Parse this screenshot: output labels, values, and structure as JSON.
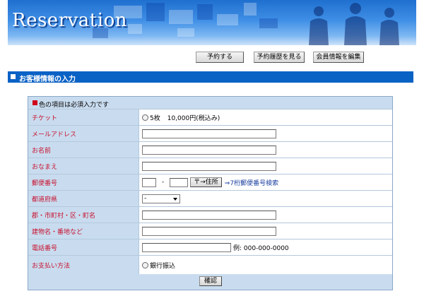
{
  "header": {
    "title": "Reservation"
  },
  "nav": {
    "reserve": "予約する",
    "history": "予約履歴を見る",
    "edit_member": "会員情報を編集"
  },
  "section": {
    "title": "お客様情報の入力"
  },
  "form": {
    "notice": "色の項目は必須入力です",
    "ticket": {
      "label": "チケット",
      "option": "5枚",
      "price": "10,000円(税込み)"
    },
    "email": {
      "label": "メールアドレス"
    },
    "name": {
      "label": "お名前"
    },
    "kana": {
      "label": "おなまえ"
    },
    "postal": {
      "label": "郵便番号",
      "separator": "-",
      "lookup_button": "〒→住所",
      "search_link": "⇒7桁郵便番号検索"
    },
    "prefecture": {
      "label": "都道府県",
      "selected": "-"
    },
    "city": {
      "label": "郡・市町村・区・町名"
    },
    "building": {
      "label": "建物名・番地など"
    },
    "phone": {
      "label": "電話番号",
      "example": "例: 000-000-0000"
    },
    "payment": {
      "label": "お支払い方法",
      "option": "銀行振込"
    },
    "confirm_button": "確認"
  },
  "colors": {
    "section_bar": "#0b62c5",
    "label_bg": "#c9dcef",
    "label_text": "#c8102e"
  }
}
